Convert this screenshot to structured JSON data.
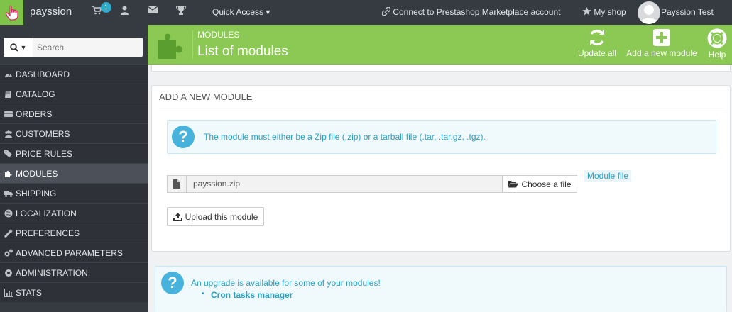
{
  "topbar": {
    "brand": "payssion",
    "cart_badge": "1",
    "quick_access": "Quick Access",
    "connect": "Connect to Prestashop Marketplace account",
    "my_shop": "My shop",
    "user": "Payssion Test"
  },
  "sidebar": {
    "search_placeholder": "Search",
    "items": [
      {
        "label": "DASHBOARD",
        "icon": "dashboard-icon"
      },
      {
        "label": "CATALOG",
        "icon": "book-icon"
      },
      {
        "label": "ORDERS",
        "icon": "credit-card-icon"
      },
      {
        "label": "CUSTOMERS",
        "icon": "users-icon"
      },
      {
        "label": "PRICE RULES",
        "icon": "tags-icon"
      },
      {
        "label": "MODULES",
        "icon": "puzzle-icon",
        "active": true
      },
      {
        "label": "SHIPPING",
        "icon": "truck-icon"
      },
      {
        "label": "LOCALIZATION",
        "icon": "globe-icon"
      },
      {
        "label": "PREFERENCES",
        "icon": "wrench-icon"
      },
      {
        "label": "ADVANCED PARAMETERS",
        "icon": "cogs-icon"
      },
      {
        "label": "ADMINISTRATION",
        "icon": "gear-icon"
      },
      {
        "label": "STATS",
        "icon": "bar-chart-icon"
      }
    ]
  },
  "header": {
    "breadcrumb": "MODULES",
    "title": "List of modules",
    "update_all": "Update all",
    "add_new": "Add a new module",
    "help": "Help"
  },
  "panel": {
    "title": "ADD A NEW MODULE",
    "alert": "The module must either be a Zip file (.zip) or a tarball file (.tar, .tar.gz, .tgz).",
    "file_value": "payssion.zip",
    "choose_label": "Choose a file",
    "module_file_label": "Module file",
    "upload_label": "Upload this module"
  },
  "upgrade": {
    "text": "An upgrade is available for some of your modules!",
    "item": "Cron tasks manager"
  },
  "colors": {
    "header_green": "#8bc954",
    "sidebar_dark": "#363a41",
    "info_blue": "#25a1c8"
  }
}
